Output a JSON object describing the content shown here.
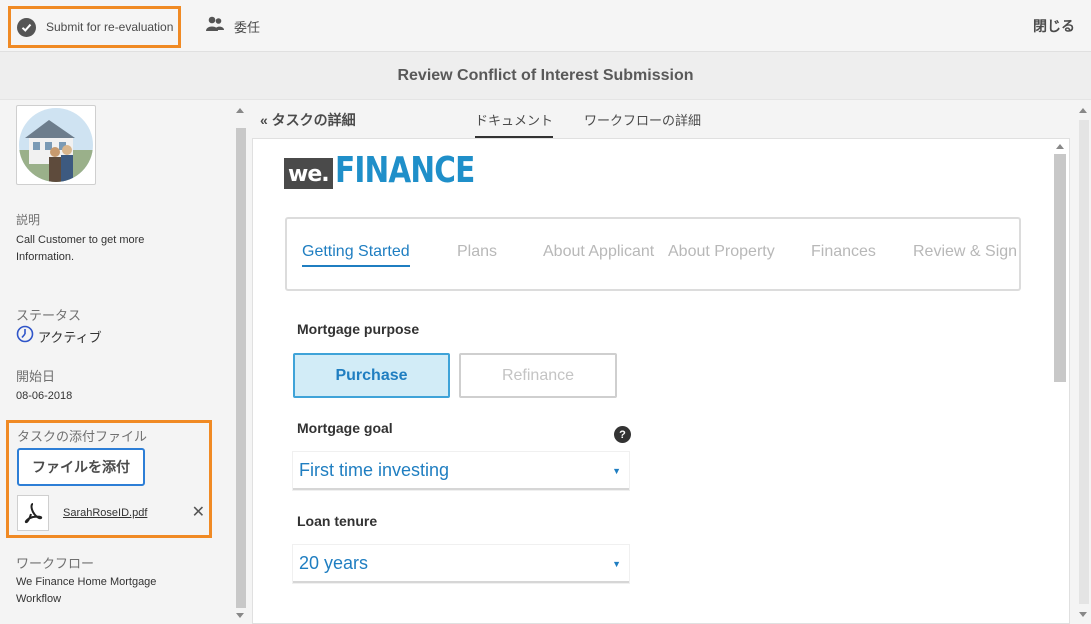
{
  "topbar": {
    "submit_label": "Submit for re-evaluation",
    "delegate_label": "委任",
    "close_label": "閉じる"
  },
  "page_title": "Review Conflict of Interest Submission",
  "left": {
    "description_label": "説明",
    "description_value": "Call Customer to get more Information.",
    "status_label": "ステータス",
    "status_value": "アクティブ",
    "start_date_label": "開始日",
    "start_date_value": "08-06-2018",
    "attachments_label": "タスクの添付ファイル",
    "attach_button": "ファイルを添付",
    "attachment_file": "SarahRoseID.pdf",
    "workflow_label": "ワークフロー",
    "workflow_value": "We Finance Home Mortgage Workflow"
  },
  "tabs": {
    "task_detail": "« タスクの詳細",
    "document": "ドキュメント",
    "workflow_detail": "ワークフローの詳細"
  },
  "form": {
    "logo_we": "we.",
    "logo_finance": "FINANCE",
    "steps": [
      "Getting Started",
      "Plans",
      "About Applicant",
      "About Property",
      "Finances",
      "Review & Sign"
    ],
    "mortgage_purpose_label": "Mortgage purpose",
    "purchase_label": "Purchase",
    "refinance_label": "Refinance",
    "mortgage_goal_label": "Mortgage goal",
    "mortgage_goal_value": "First time investing",
    "loan_tenure_label": "Loan tenure",
    "loan_tenure_value": "20 years",
    "help_glyph": "?"
  },
  "colors": {
    "highlight": "#f08a24",
    "accent": "#1f7ec1",
    "brand": "#1f8fc9"
  }
}
